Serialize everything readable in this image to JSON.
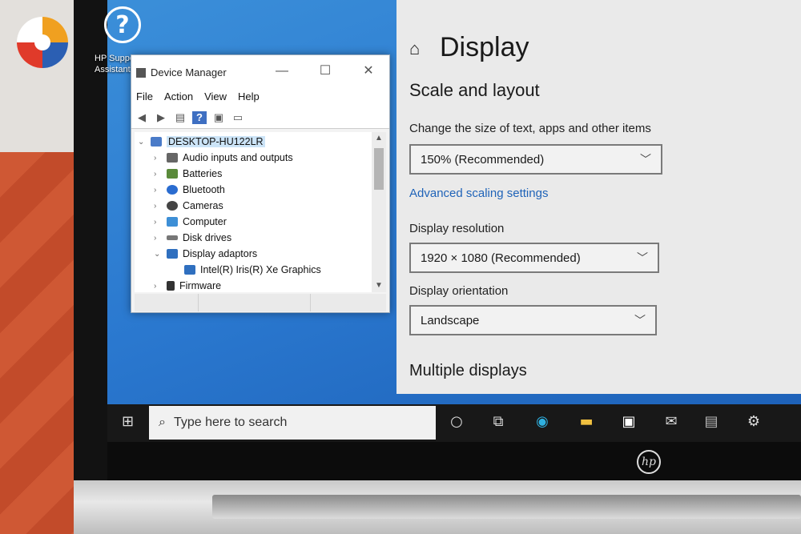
{
  "desktop": {
    "icon_label": "HP Support Assistant"
  },
  "device_manager": {
    "title": "Device Manager",
    "menu": [
      "File",
      "Action",
      "View",
      "Help"
    ],
    "tree": [
      {
        "label": "DESKTOP-HU122LR",
        "level": 0,
        "expanded": true,
        "selected": true
      },
      {
        "label": "Audio inputs and outputs",
        "level": 1,
        "expanded": false
      },
      {
        "label": "Batteries",
        "level": 1,
        "expanded": false
      },
      {
        "label": "Bluetooth",
        "level": 1,
        "expanded": false
      },
      {
        "label": "Cameras",
        "level": 1,
        "expanded": false
      },
      {
        "label": "Computer",
        "level": 1,
        "expanded": false
      },
      {
        "label": "Disk drives",
        "level": 1,
        "expanded": false
      },
      {
        "label": "Display adaptors",
        "level": 1,
        "expanded": true
      },
      {
        "label": "Intel(R) Iris(R) Xe Graphics",
        "level": 2
      },
      {
        "label": "Firmware",
        "level": 1,
        "expanded": false
      }
    ]
  },
  "settings": {
    "title": "Display",
    "section_scale": "Scale and layout",
    "change_size_label": "Change the size of text, apps and other items",
    "scale_value": "150% (Recommended)",
    "advanced_link": "Advanced scaling settings",
    "resolution_label": "Display resolution",
    "resolution_value": "1920 × 1080 (Recommended)",
    "orientation_label": "Display orientation",
    "orientation_value": "Landscape",
    "section_multiple": "Multiple displays"
  },
  "taskbar": {
    "search_placeholder": "Type here to search"
  },
  "brand": {
    "laptop_logo": "hp"
  },
  "colors": {
    "accent_link": "#1f63b8",
    "desktop_blue": "#2a78cf",
    "selected_row": "#cce4f7"
  }
}
